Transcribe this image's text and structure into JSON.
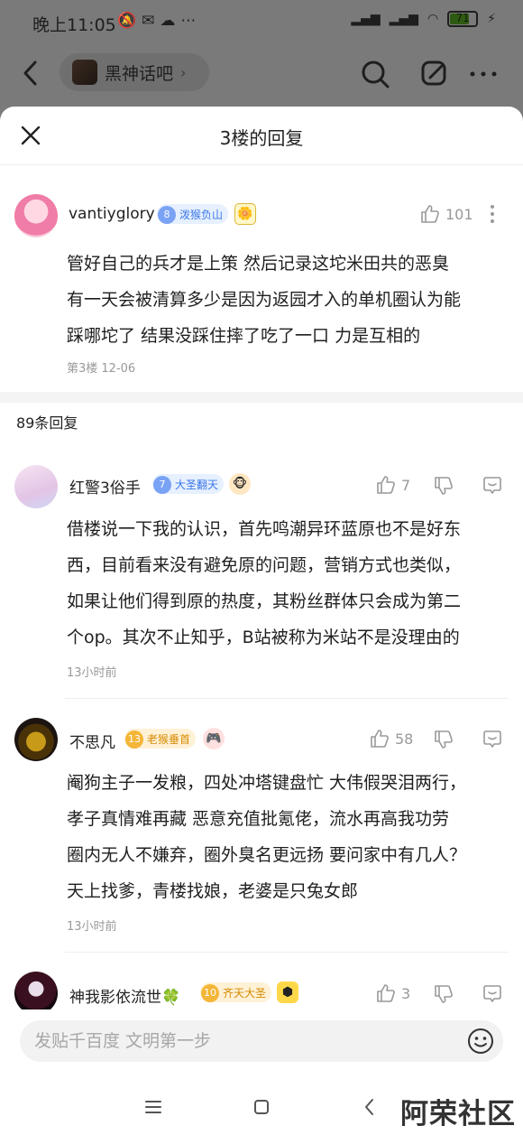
{
  "status_bar": {
    "time": "晚上11:05",
    "battery": "71"
  },
  "header": {
    "forum_name": "黑神话吧"
  },
  "sheet": {
    "title": "3楼的回复"
  },
  "main_post": {
    "username": "vantiyglory",
    "level": "8",
    "title": "泼猴负山",
    "likes": "101",
    "text_lines": [
      "管好自己的兵才是上策 然后记录这坨米田共的恶臭",
      "有一天会被清算多少是因为返园才入的单机圈认为能",
      "踩哪坨了 结果没踩住摔了吃了一口 力是互相的"
    ],
    "meta": "第3楼  12-06"
  },
  "reply_count": "89条回复",
  "replies": [
    {
      "username": "红警3俗手",
      "level": "7",
      "title": "大圣翻天",
      "level_color": "blue",
      "likes": "7",
      "text_lines": [
        "借楼说一下我的认识，首先鸣潮异环蓝原也不是好东",
        "西，目前看来没有避免原的问题，营销方式也类似，",
        "如果让他们得到原的热度，其粉丝群体只会成为第二",
        "个op。其次不止知乎，B站被称为米站不是没理由的"
      ],
      "time": "13小时前"
    },
    {
      "username": "不思凡",
      "level": "13",
      "title": "老猴垂首",
      "level_color": "gold",
      "likes": "58",
      "text_lines": [
        "阉狗主子一发粮，四处冲塔键盘忙 大伟假哭泪两行，",
        "孝子真情难再藏 恶意充值批氪佬，流水再高我功劳",
        "圈内无人不嫌弃，圈外臭名更远扬 要问家中有几人？",
        "天上找爹，青楼找娘，老婆是只兔女郎"
      ],
      "time": "13小时前"
    },
    {
      "username": "神我影依流世🍀",
      "level": "10",
      "title": "齐天大圣",
      "level_color": "gold",
      "likes": "3",
      "text_lines": [],
      "time": ""
    }
  ],
  "input": {
    "placeholder": "发贴千百度 文明第一步"
  },
  "watermark": "阿荣社区",
  "colors": {
    "accent_blue": "#3a78e8",
    "gold": "#d68a00",
    "bg_dim": "#7a7a7a"
  }
}
